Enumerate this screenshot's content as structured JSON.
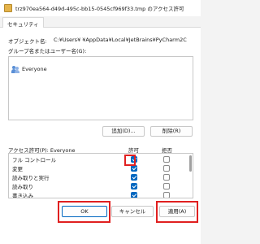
{
  "window": {
    "title": "trz970ea564-d49d-495c-bb15-0545cf969f33.tmp のアクセス許可",
    "icon": "folder-icon"
  },
  "tabs": [
    {
      "label": "セキュリティ"
    }
  ],
  "object": {
    "label": "オブジェクト名:",
    "path": "C:¥Users¥      ¥AppData¥Local¥JetBrains¥PyCharm2C"
  },
  "groups": {
    "label": "グループ名またはユーザー名(G):",
    "items": [
      {
        "label": "Everyone",
        "icon": "people-icon"
      }
    ]
  },
  "buttons": {
    "add": "追加(D)...",
    "remove": "削除(R)"
  },
  "permissions": {
    "label": "アクセス許可(P): Everyone",
    "allow_header": "許可",
    "deny_header": "拒否",
    "rows": [
      {
        "label": "フル コントロール",
        "allow": true,
        "deny": false
      },
      {
        "label": "変更",
        "allow": true,
        "deny": false
      },
      {
        "label": "読み取りと実行",
        "allow": true,
        "deny": false
      },
      {
        "label": "読み取り",
        "allow": true,
        "deny": false
      },
      {
        "label": "書き込み",
        "allow": true,
        "deny": false
      }
    ]
  },
  "footer": {
    "ok": "OK",
    "cancel": "キャンセル",
    "apply": "適用(A)"
  },
  "colors": {
    "accent": "#0067c0",
    "highlight": "#e02020"
  }
}
